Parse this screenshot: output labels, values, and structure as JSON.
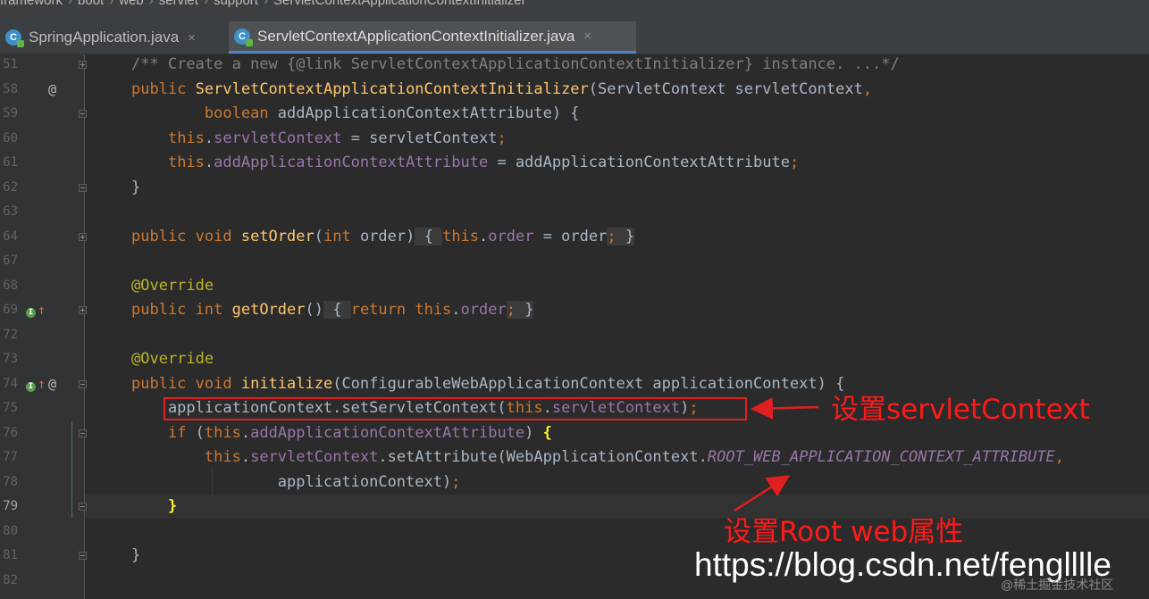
{
  "breadcrumb": [
    "framework",
    "boot",
    "web",
    "servlet",
    "support",
    "ServletContextApplicationContextInitializer"
  ],
  "tabs": [
    {
      "label": "SpringApplication.java",
      "icon": "java-class-icon",
      "active": false
    },
    {
      "label": "ServletContextApplicationContextInitializer.java",
      "icon": "java-class-icon",
      "active": true
    }
  ],
  "close_glyph": "×",
  "lines": [
    {
      "n": "51",
      "html": "<span class=\"cmt\">/** Create a new {@link ServletContextApplicationContextInitializer} instance. ...*/</span>",
      "fold": "plus"
    },
    {
      "n": "58",
      "html": "<span class=\"kw\">public</span> <span class=\"fn\">ServletContextApplicationContextInitializer</span>(ServletContext servletContext<span class=\"kw\">,</span>",
      "gicon": "@"
    },
    {
      "n": "59",
      "html": "        <span class=\"kw\">boolean</span> addApplicationContextAttribute) {",
      "fold": "minus"
    },
    {
      "n": "60",
      "html": "    <span class=\"kw\">this</span>.<span class=\"fld\">servletContext</span> = servletContext<span class=\"kw\">;</span>"
    },
    {
      "n": "61",
      "html": "    <span class=\"kw\">this</span>.<span class=\"fld\">addApplicationContextAttribute</span> = addApplicationContextAttribute<span class=\"kw\">;</span>"
    },
    {
      "n": "62",
      "html": "}",
      "fold": "minus"
    },
    {
      "n": "63",
      "html": ""
    },
    {
      "n": "64",
      "html": "<span class=\"kw\">public void</span> <span class=\"fn\">setOrder</span>(<span class=\"kw\">int</span> order)<span class=\"fb\"> { </span><span class=\"kw\">this</span>.<span class=\"fld\">order</span> = order<span class=\"fb\"><span class=\"kw\">;</span> }</span>",
      "fold": "plus"
    },
    {
      "n": "67",
      "html": ""
    },
    {
      "n": "68",
      "html": "<span class=\"ann\">@Override</span>"
    },
    {
      "n": "69",
      "html": "<span class=\"kw\">public int</span> <span class=\"fn\">getOrder</span>()<span class=\"fb\"> { </span><span class=\"kw\">return this</span>.<span class=\"fld\">order</span><span class=\"fb\"><span class=\"kw\">;</span> }</span>",
      "fold": "plus",
      "override": true
    },
    {
      "n": "72",
      "html": ""
    },
    {
      "n": "73",
      "html": "<span class=\"ann\">@Override</span>"
    },
    {
      "n": "74",
      "html": "<span class=\"kw\">public void</span> <span class=\"fn\">initialize</span>(ConfigurableWebApplicationContext applicationContext) {",
      "fold": "minus",
      "override": true,
      "gicon": "@"
    },
    {
      "n": "75",
      "html": "    applicationContext.setServletContext(<span class=\"kw\">this</span>.<span class=\"fld\">servletContext</span>)<span class=\"kw\">;</span>"
    },
    {
      "n": "76",
      "html": "    <span class=\"kw\">if</span> (<span class=\"kw\">this</span>.<span class=\"fld\">addApplicationContextAttribute</span>) <span class=\"brace-match\">{</span>",
      "fold": "minus"
    },
    {
      "n": "77",
      "html": "        <span class=\"kw\">this</span>.<span class=\"fld\">servletContext</span>.setAttribute(WebApplicationContext.<span class=\"stat\">ROOT_WEB_APPLICATION_CONTEXT_ATTRIBUTE</span><span class=\"kw\">,</span>"
    },
    {
      "n": "78",
      "html": "                applicationContext)<span class=\"kw\">;</span>"
    },
    {
      "n": "79",
      "html": "    <span class=\"brace-match\">}</span>",
      "fold": "minus",
      "current": true
    },
    {
      "n": "80",
      "html": ""
    },
    {
      "n": "81",
      "html": "}",
      "fold": "minus"
    },
    {
      "n": "82",
      "html": ""
    }
  ],
  "annotations": {
    "set_servlet_context": "设置servletContext",
    "set_root_web_attr": "设置Root web属性",
    "watermark": "https://blog.csdn.net/fenglllle",
    "watermark_small": "@稀土掘金技术社区"
  },
  "colors": {
    "annotation_red": "#e02020",
    "editor_bg": "#2b2b2b",
    "keyword": "#cc7832",
    "method": "#ffc66d",
    "field": "#9876aa"
  }
}
